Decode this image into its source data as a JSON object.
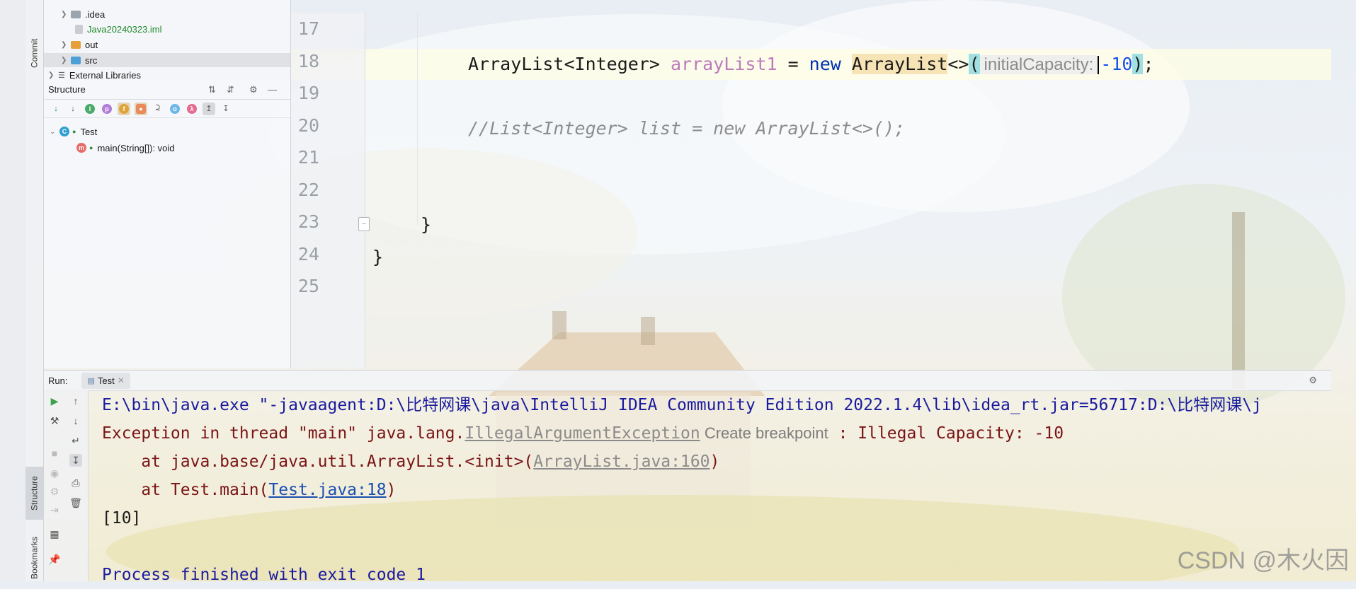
{
  "project_tree": {
    "items": [
      {
        "label": ".idea",
        "type": "folder",
        "expanded": false,
        "color": "#9aa4ad"
      },
      {
        "label": "Java20240323.iml",
        "type": "file",
        "color": "#1f8a2a"
      },
      {
        "label": "out",
        "type": "folder",
        "expanded": false,
        "color": "#e5a03a"
      },
      {
        "label": "src",
        "type": "folder",
        "expanded": false,
        "color": "#4c9fd7"
      },
      {
        "label": "External Libraries",
        "type": "library",
        "expanded": false
      }
    ]
  },
  "left_tabs": {
    "commit": "Commit",
    "structure": "Structure",
    "bookmarks": "Bookmarks"
  },
  "structure": {
    "title": "Structure",
    "class_name": "Test",
    "method": "main(String[]): void"
  },
  "editor": {
    "line_numbers": [
      "17",
      "18",
      "19",
      "20",
      "21",
      "22",
      "23",
      "24",
      "25"
    ],
    "code": {
      "l18_type": "ArrayList<Integer>",
      "l18_var": "arrayList1",
      "l18_eq": " = ",
      "l18_new": "new",
      "l18_cls": "ArrayList",
      "l18_diamond": "<>",
      "l18_open": "(",
      "l18_hint": "initialCapacity:",
      "l18_num": "-10",
      "l18_close": ")",
      "l18_semi": ";",
      "l20_comment": "//List<Integer> list = new ArrayList<>();",
      "l23_brace": "}",
      "l24_brace": "}"
    }
  },
  "run": {
    "label": "Run:",
    "tab": "Test",
    "console": {
      "line1": "E:\\bin\\java.exe \"-javaagent:D:\\比特网课\\java\\IntelliJ IDEA Community Edition 2022.1.4\\lib\\idea_rt.jar=56717:D:\\比特网课\\j",
      "line2_prefix": "Exception in thread \"main\" java.lang.",
      "line2_exc": "IllegalArgumentException",
      "line2_hint": "Create breakpoint",
      "line2_msg": " : Illegal Capacity: -10",
      "line3_prefix": "    at java.base/java.util.ArrayList.<init>(",
      "line3_link": "ArrayList.java:160",
      "line3_suffix": ")",
      "line4_prefix": "    at Test.main(",
      "line4_link": "Test.java:18",
      "line4_suffix": ")",
      "line5": "[10]",
      "line7": "Process finished with exit code 1"
    }
  },
  "watermark": "CSDN @木火因"
}
